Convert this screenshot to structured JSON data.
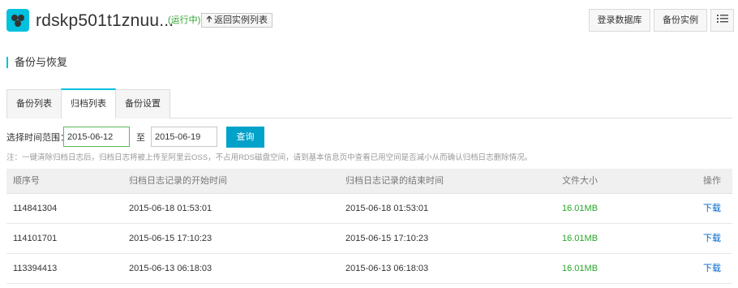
{
  "header": {
    "instance_name": "rdskp501t1znuu...",
    "status": "(运行中)",
    "back_label": "返回实例列表",
    "login_db_label": "登录数据库",
    "backup_instance_label": "备份实例"
  },
  "section": {
    "title": "备份与恢复"
  },
  "tabs": [
    {
      "label": "备份列表",
      "active": false
    },
    {
      "label": "归档列表",
      "active": true
    },
    {
      "label": "备份设置",
      "active": false
    }
  ],
  "filter": {
    "range_label": "选择时间范围：",
    "start_date": "2015-06-12",
    "to_label": "至",
    "end_date": "2015-06-19",
    "query_label": "查询"
  },
  "note": "注：一键清除归档日志后，归档日志将被上传至阿里云OSS，不占用RDS磁盘空间，请到基本信息页中查看已用空间是否减小从而确认归档日志删除情况。",
  "table": {
    "headers": [
      "顺序号",
      "归档日志记录的开始时间",
      "归档日志记录的结束时间",
      "文件大小",
      "操作"
    ],
    "rows": [
      {
        "seq": "114841304",
        "start": "2015-06-18 01:53:01",
        "end": "2015-06-18 01:53:01",
        "size": "16.01MB",
        "action": "下载"
      },
      {
        "seq": "114101701",
        "start": "2015-06-15 17:10:23",
        "end": "2015-06-15 17:10:23",
        "size": "16.01MB",
        "action": "下载"
      },
      {
        "seq": "113394413",
        "start": "2015-06-13 06:18:03",
        "end": "2015-06-13 06:18:03",
        "size": "16.01MB",
        "action": "下载"
      }
    ]
  },
  "colors": {
    "accent": "#00c1de",
    "status_green": "#2ca02c",
    "size_green": "#2aa52a",
    "link_blue": "#0066cc",
    "query_button": "#00a2ca"
  },
  "icons": {
    "app": "rds-logo-icon",
    "back": "arrow-up-icon",
    "menu": "list-menu-icon"
  }
}
